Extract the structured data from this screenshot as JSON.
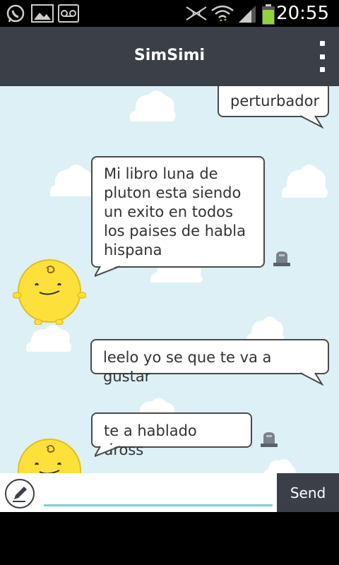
{
  "status_bar": {
    "time": "20:55",
    "icons": [
      "whatsapp-icon",
      "gallery-icon",
      "voicemail-icon",
      "nfc-icon",
      "wifi-icon",
      "signal-icon",
      "battery-icon"
    ]
  },
  "app_bar": {
    "title": "SimSimi",
    "menu_icon": "overflow-menu-icon"
  },
  "chat": {
    "messages": [
      {
        "sender": "user",
        "text": "perturbador"
      },
      {
        "sender": "bot",
        "text": "Mi libro luna de\npluton esta siendo\nun exito en todos\nlos paises de habla\nhispana"
      },
      {
        "sender": "user",
        "text": "leelo yo se que te va a gustar"
      },
      {
        "sender": "bot",
        "text": "te a hablado dross"
      }
    ]
  },
  "input_bar": {
    "placeholder": "",
    "value": "",
    "send_label": "Send"
  },
  "colors": {
    "app_bar": "#3a3f48",
    "chat_background": "#dcf0f6",
    "avatar": "#fde13a",
    "input_underline": "#7ccfcf"
  }
}
